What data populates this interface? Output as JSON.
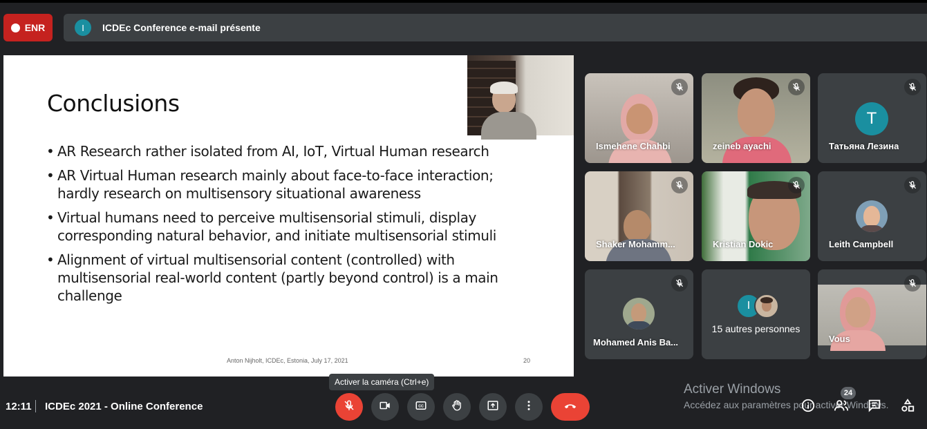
{
  "recording": {
    "label": "ENR",
    "color": "#c5221f"
  },
  "presentation": {
    "avatar_letter": "I",
    "text": "ICDEc Conference e-mail présente"
  },
  "slide": {
    "title": "Conclusions",
    "bullets": [
      "AR Research rather isolated from AI, IoT, Virtual Human research",
      "AR Virtual Human research mainly about face-to-face interaction; hardly research on multisensory situational awareness",
      "Virtual humans need to perceive multisensorial stimuli, display corresponding natural behavior, and initiate multisensorial stimuli",
      "Alignment of virtual multisensorial content (controlled) with multisensorial real-world content (partly beyond control) is a main challenge"
    ],
    "footer": "Anton Nijholt, ICDEc, Estonia, July 17, 2021",
    "page": "20"
  },
  "participants": [
    {
      "name": "Ismehene Chahbi",
      "muted": true
    },
    {
      "name": "zeineb ayachi",
      "muted": true
    },
    {
      "name": "Татьяна Лезина",
      "muted": true,
      "avatar_letter": "T"
    },
    {
      "name": "Shaker Mohamm...",
      "muted": true
    },
    {
      "name": "Kristian Dokic",
      "muted": true
    },
    {
      "name": "Leith Campbell",
      "muted": true
    },
    {
      "name": "Mohamed Anis Ba...",
      "muted": true
    },
    {
      "name": "15 autres personnes",
      "avatar_letter": "I"
    },
    {
      "name": "Vous",
      "muted": true
    }
  ],
  "meeting": {
    "time": "12:11",
    "title": "ICDEc 2021 - Online Conference"
  },
  "controls": {
    "tooltip": "Activer la caméra (Ctrl+e)",
    "accent_red": "#ea4335",
    "people_count": "24"
  },
  "windows_watermark": {
    "title": "Activer Windows",
    "subtitle": "Accédez aux paramètres pour activer Windows."
  }
}
